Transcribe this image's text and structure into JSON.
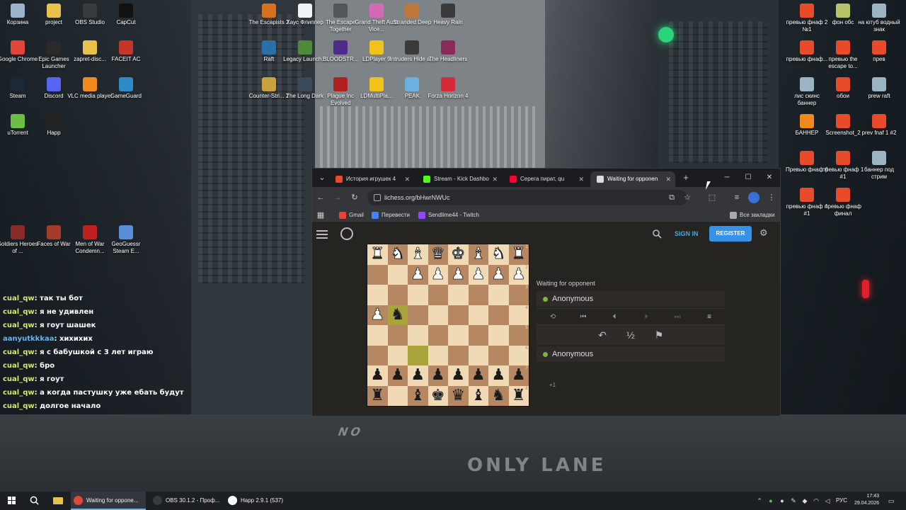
{
  "desktop": {
    "icons_left": [
      {
        "label": "Корзина",
        "color": "#9bb4c9"
      },
      {
        "label": "project",
        "color": "#e8c24a"
      },
      {
        "label": "OBS Studio",
        "color": "#3a3a3a"
      },
      {
        "label": "CapCut",
        "color": "#111111"
      },
      {
        "label": "Google Chrome",
        "color": "#e0463a"
      },
      {
        "label": "Epic Games Launcher",
        "color": "#2a2a2a"
      },
      {
        "label": "zapret-disc...",
        "color": "#e8c24a"
      },
      {
        "label": "FACEIT AC",
        "color": "#c6352b"
      },
      {
        "label": "Steam",
        "color": "#1b2838"
      },
      {
        "label": "Discord",
        "color": "#5865f2"
      },
      {
        "label": "VLC media player",
        "color": "#f08a1c"
      },
      {
        "label": "GameGuard",
        "color": "#2d8bc7"
      },
      {
        "label": "uTorrent",
        "color": "#6cbf45"
      },
      {
        "label": "Happ",
        "color": "#222222"
      },
      {
        "label": "Soldiers Heroes of ...",
        "color": "#8a2a2a"
      },
      {
        "label": "Faces of War",
        "color": "#a33a2a"
      },
      {
        "label": "Men of War Condemn...",
        "color": "#c02020"
      },
      {
        "label": "GeoGuessr Steam E...",
        "color": "#5a8fd8"
      }
    ],
    "icons_center": [
      {
        "label": "The Escapists 2",
        "color": "#d7711f"
      },
      {
        "label": "Хаус Флиппер",
        "color": "#f2f2f2"
      },
      {
        "label": "The Escape Together",
        "color": "#555555"
      },
      {
        "label": "Grand Theft Auto Vice...",
        "color": "#d46ab6"
      },
      {
        "label": "Stranded Deep",
        "color": "#c0783a"
      },
      {
        "label": "Heavy Rain",
        "color": "#3a3a3a"
      },
      {
        "label": "Raft",
        "color": "#2b6fa8"
      },
      {
        "label": "Legacy Launch...",
        "color": "#4f8a3a"
      },
      {
        "label": "BLOODSTR...",
        "color": "#4e2a8a"
      },
      {
        "label": "LDPlayer 9",
        "color": "#f2c21a"
      },
      {
        "label": "Intruders Hide a...",
        "color": "#3a3a3a"
      },
      {
        "label": "The Headliners",
        "color": "#8a2a5a"
      },
      {
        "label": "Counter-Stri... 2",
        "color": "#c8a23a"
      },
      {
        "label": "The Long Dark",
        "color": "#3a4a5a"
      },
      {
        "label": "Plague Inc Evolved",
        "color": "#b02020"
      },
      {
        "label": "LDMultiPla...",
        "color": "#f2c21a"
      },
      {
        "label": "PEAK",
        "color": "#6ab0e0"
      },
      {
        "label": "Forza Horizon 4",
        "color": "#d8283a"
      }
    ],
    "icons_right": [
      {
        "label": "превью фнаф 2 №1",
        "color": "#e84a2a"
      },
      {
        "label": "фон обс",
        "color": "#b8c46a"
      },
      {
        "label": "на ютуб водный знак",
        "color": "#9ab4c4"
      },
      {
        "label": "превью фнаф...",
        "color": "#e84a2a"
      },
      {
        "label": "превью the escape to...",
        "color": "#e84a2a"
      },
      {
        "label": "прев",
        "color": "#e84a2a"
      },
      {
        "label": "лис скинс баннер",
        "color": "#9ab4c4"
      },
      {
        "label": "обои",
        "color": "#e84a2a"
      },
      {
        "label": "prew raft",
        "color": "#9ab4c4"
      },
      {
        "label": "БАННЕР",
        "color": "#f08a1c"
      },
      {
        "label": "Screenshot_2",
        "color": "#e84a2a"
      },
      {
        "label": "prev fnaf 1 #2",
        "color": "#e84a2a"
      },
      {
        "label": "Превью фнаф 6",
        "color": "#e84a2a"
      },
      {
        "label": "превью фнаф 1 #1",
        "color": "#e84a2a"
      },
      {
        "label": "баннер под стрим",
        "color": "#9ab4c4"
      },
      {
        "label": "превью фнаф 4 #1",
        "color": "#e84a2a"
      },
      {
        "label": "превью фнаф финал",
        "color": "#e84a2a"
      }
    ],
    "road_text": {
      "no": "NO",
      "only": "ONLY LANE"
    }
  },
  "chat": [
    {
      "user": "cual_qw",
      "msg": "так ты бот"
    },
    {
      "user": "cual_qw",
      "msg": "я не удивлен"
    },
    {
      "user": "cual_qw",
      "msg": "я гоут шашек"
    },
    {
      "user": "aanyutkkkaa",
      "msg": "хихихих"
    },
    {
      "user": "cual_qw",
      "msg": "я с бабушкой с 3 лет играю"
    },
    {
      "user": "cual_qw",
      "msg": "бро"
    },
    {
      "user": "cual_qw",
      "msg": "я гоут"
    },
    {
      "user": "cual_qw",
      "msg": "а когда пастушку уже ебать будут"
    },
    {
      "user": "cual_qw",
      "msg": "долгое начало"
    }
  ],
  "browser": {
    "tabs": [
      {
        "label": "История игрушек 4",
        "color": "#e84a2a",
        "active": false
      },
      {
        "label": "Stream - Kick Dashbo",
        "color": "#53fc18",
        "active": false
      },
      {
        "label": "Серега пират, qu",
        "color": "#ff0033",
        "active": false
      },
      {
        "label": "Waiting for opponen",
        "color": "#dddddd",
        "active": true
      }
    ],
    "url": "lichess.org/bHwrNWUc",
    "bookmarks": [
      {
        "label": "Gmail",
        "color": "#ea4335"
      },
      {
        "label": "Перевести",
        "color": "#4285f4"
      },
      {
        "label": "Sendlime44 - Twitch",
        "color": "#9146ff"
      }
    ],
    "all_bookmarks": "Все закладки"
  },
  "lichess": {
    "sign_in": "SIGN IN",
    "register": "REGISTER",
    "status": "Waiting for opponent",
    "top_player": "Anonymous",
    "bottom_player": "Anonymous",
    "draw_label": "½",
    "plus_label": "+1",
    "board": [
      [
        "wr",
        "wn",
        "wb",
        "wq",
        "wk",
        "wb",
        "wn",
        "wr"
      ],
      [
        "",
        "",
        "wp",
        "wp",
        "wp",
        "wp",
        "wp",
        "wp"
      ],
      [
        "",
        "",
        "",
        "",
        "",
        "",
        "",
        ""
      ],
      [
        "wp",
        "bn",
        "",
        "",
        "",
        "",
        "",
        ""
      ],
      [
        "",
        "",
        "",
        "",
        "",
        "",
        "",
        ""
      ],
      [
        "",
        "",
        "",
        "",
        "",
        "",
        "",
        ""
      ],
      [
        "bp",
        "bp",
        "bp",
        "bp",
        "bp",
        "bp",
        "bp",
        "bp"
      ],
      [
        "br",
        "",
        "bb",
        "bk",
        "bq",
        "bb",
        "bn",
        "br"
      ]
    ],
    "ranks": [
      "1",
      "2",
      "3",
      "4",
      "5",
      "6",
      "7",
      "8"
    ],
    "files": [
      "h",
      "g",
      "f",
      "e",
      "d",
      "c",
      "b",
      "a"
    ],
    "highlight_square": "c6 from black view"
  },
  "taskbar": {
    "apps": [
      {
        "label": "Waiting for oppone...",
        "color": "#e0463a",
        "active": true
      },
      {
        "label": "OBS 30.1.2 - Проф...",
        "color": "#3a3a3a",
        "active": false
      },
      {
        "label": "Happ 2.9.1 (537)",
        "color": "#ffffff",
        "active": false
      }
    ],
    "lang": "РУС",
    "time": "17:43",
    "date": "29.04.2026"
  }
}
